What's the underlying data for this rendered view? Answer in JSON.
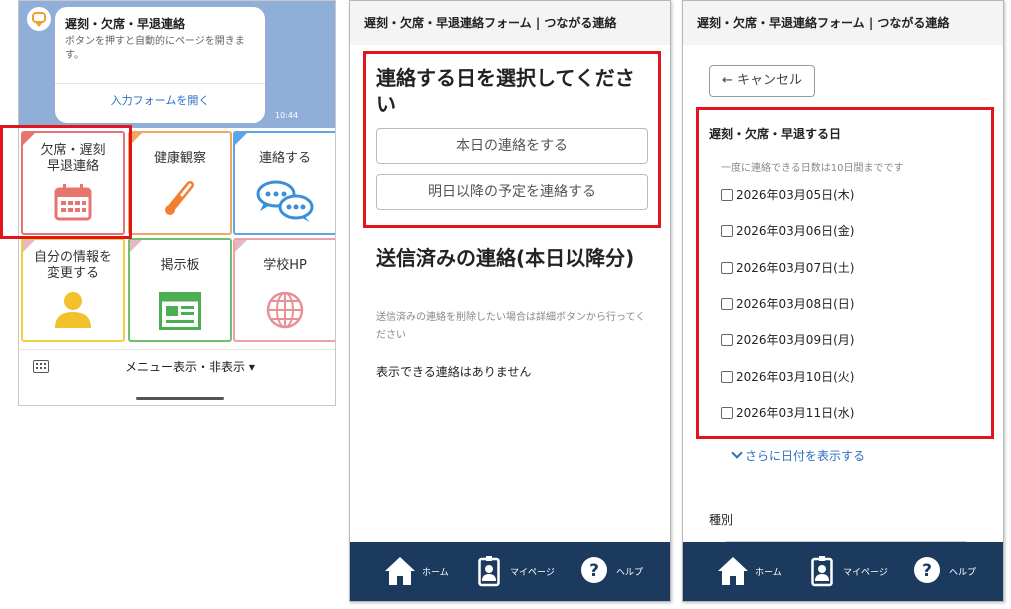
{
  "panel1": {
    "message": {
      "title": "遅刻・欠席・早退連絡",
      "body": "ボタンを押すと自動的にページを開きます。",
      "link": "入力フォームを開く",
      "time": "10:44"
    },
    "tiles": [
      {
        "label": "欠席・遅刻\n早退連絡",
        "color": "#e87470",
        "icon": "calendar-icon"
      },
      {
        "label": "健康観察",
        "color": "#f0a860",
        "icon": "thermometer-icon"
      },
      {
        "label": "連絡する",
        "color": "#5aa6e6",
        "icon": "chat-bubbles-icon"
      },
      {
        "label": "自分の情報を\n変更する",
        "color": "#f0d040",
        "icon": "person-icon"
      },
      {
        "label": "掲示板",
        "color": "#6cc070",
        "icon": "board-icon"
      },
      {
        "label": "学校HP",
        "color": "#f0a0a8",
        "icon": "globe-icon"
      }
    ],
    "menu_toggle": "メニュー表示・非表示 ▾"
  },
  "panel2": {
    "header": "遅刻・欠席・早退連絡フォーム | つながる連絡",
    "select_heading": "連絡する日を選択してください",
    "btn_today": "本日の連絡をする",
    "btn_future": "明日以降の予定を連絡する",
    "sent_heading": "送信済みの連絡(本日以降分)",
    "sent_note": "送信済みの連絡を削除したい場合は詳細ボタンから行ってください",
    "empty": "表示できる連絡はありません"
  },
  "panel3": {
    "header": "遅刻・欠席・早退連絡フォーム | つながる連絡",
    "cancel": "キャンセル",
    "section_title": "遅刻・欠席・早退する日",
    "section_note": "一度に連絡できる日数は10日間までです",
    "dates": [
      "2026年03月05日(木)",
      "2026年03月06日(金)",
      "2026年03月07日(土)",
      "2026年03月08日(日)",
      "2026年03月09日(月)",
      "2026年03月10日(火)",
      "2026年03月11日(水)"
    ],
    "more": "さらに日付を表示する",
    "kind_label": "種別"
  },
  "footer": {
    "home": "ホーム",
    "mypage": "マイページ",
    "help": "ヘルプ"
  },
  "colors": {
    "highlight": "#e1161d",
    "footer_bg": "#1c3a5e",
    "link": "#2a6fc2",
    "chat_bg": "#8faed8"
  }
}
